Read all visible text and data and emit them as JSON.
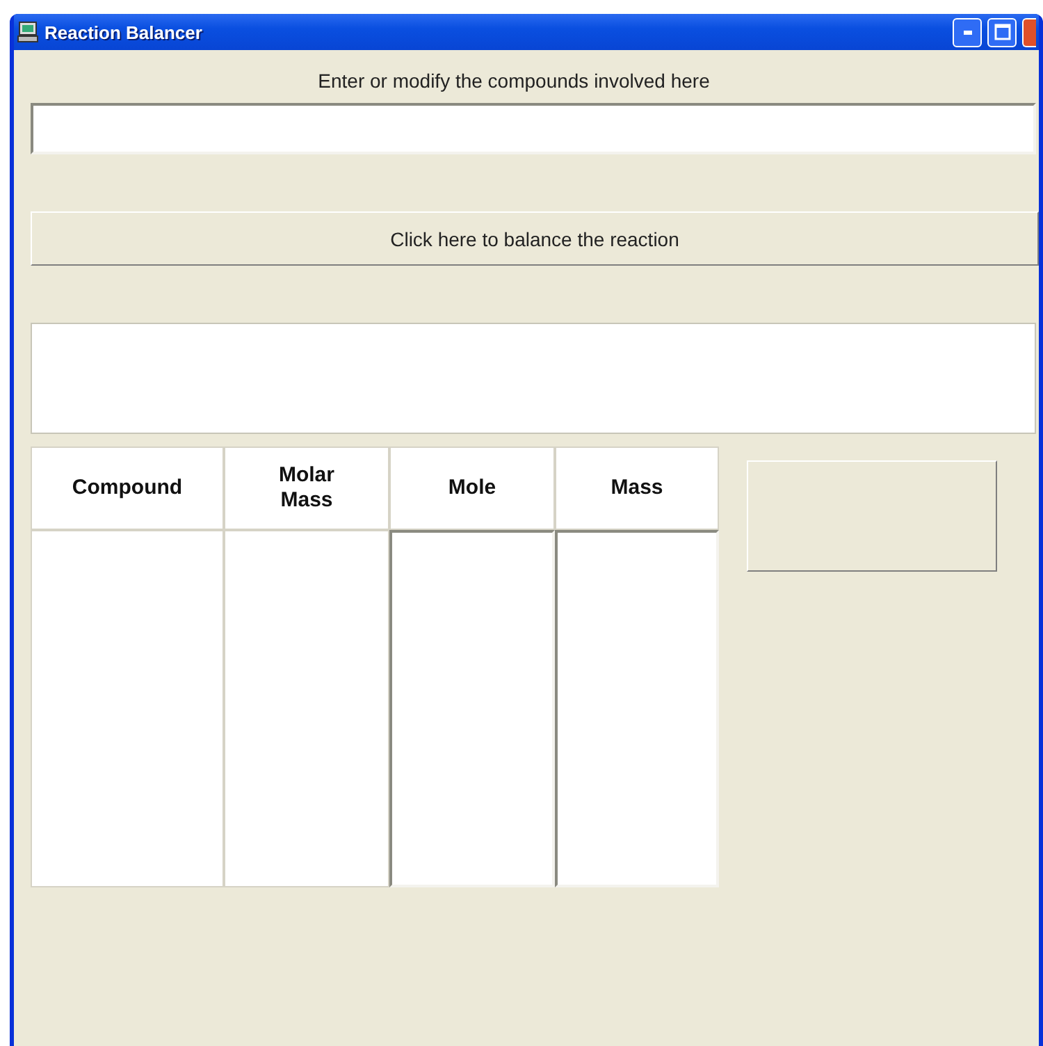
{
  "window": {
    "title": "Reaction Balancer"
  },
  "prompt": "Enter or modify the compounds involved here",
  "balance_button": "Click here to balance the reaction",
  "table": {
    "columns": [
      {
        "heading": "Compound",
        "editable": false
      },
      {
        "heading": "Molar Mass",
        "editable": false
      },
      {
        "heading": "Mole",
        "editable": true
      },
      {
        "heading": "Mass",
        "editable": true
      }
    ]
  }
}
